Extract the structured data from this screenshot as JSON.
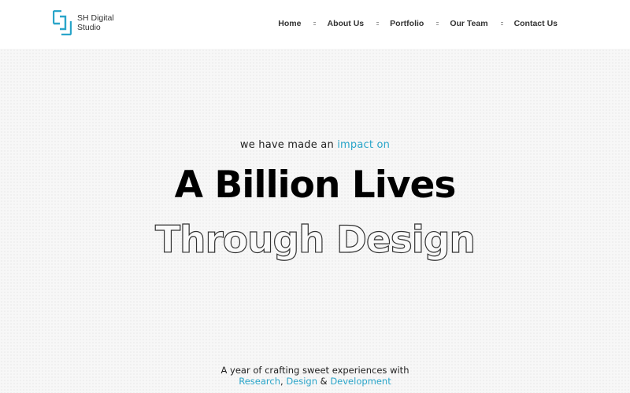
{
  "brand": {
    "name_line1": "SH Digital",
    "name_line2": "Studio",
    "accent_color": "#2aa5c9",
    "logo_icon": "bracket-square-icon"
  },
  "nav": {
    "items": [
      "Home",
      "About Us",
      "Portfolio",
      "Our Team",
      "Contact Us"
    ]
  },
  "hero": {
    "tagline_prefix": "we have made an ",
    "tagline_accent": "impact on",
    "headline": "A Billion Lives",
    "outline_headline": "Through Design",
    "sub_line1": "A year of crafting sweet experiences with",
    "sub_link1": "Research",
    "sub_sep1": ", ",
    "sub_link2": "Design",
    "sub_sep2": " & ",
    "sub_link3": "Development"
  }
}
